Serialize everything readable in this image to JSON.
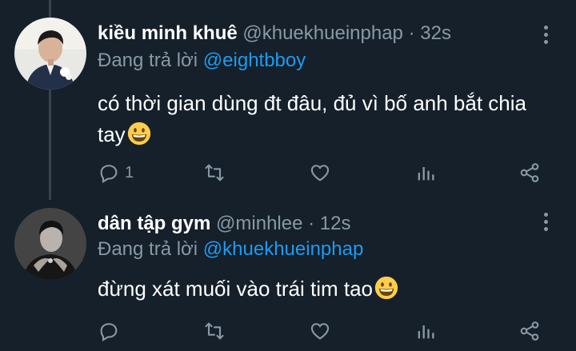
{
  "tweets": [
    {
      "name": "kiều minh khuê",
      "handle": "@khuekhueinphap",
      "separator": "·",
      "time": "32s",
      "reply_prefix": "Đang trả lời",
      "reply_to": "@eightbboy",
      "text": "có thời gian dùng đt đâu, đủ vì bố anh bắt chia tay",
      "emoji": "grinning-face",
      "reply_count": "1"
    },
    {
      "name": "dân tập gym",
      "handle": "@minhlee",
      "separator": "·",
      "time": "12s",
      "reply_prefix": "Đang trả lời",
      "reply_to": "@khuekhueinphap",
      "text": "đừng xát muối vào trái tim tao",
      "emoji": "grinning-face",
      "reply_count": ""
    }
  ],
  "colors": {
    "background": "#15202b",
    "muted": "#8899a6",
    "accent": "#1d9bf0",
    "thread_line": "#38444d"
  },
  "icons": [
    "reply-icon",
    "retweet-icon",
    "like-icon",
    "stats-icon",
    "share-icon",
    "more-icon"
  ]
}
